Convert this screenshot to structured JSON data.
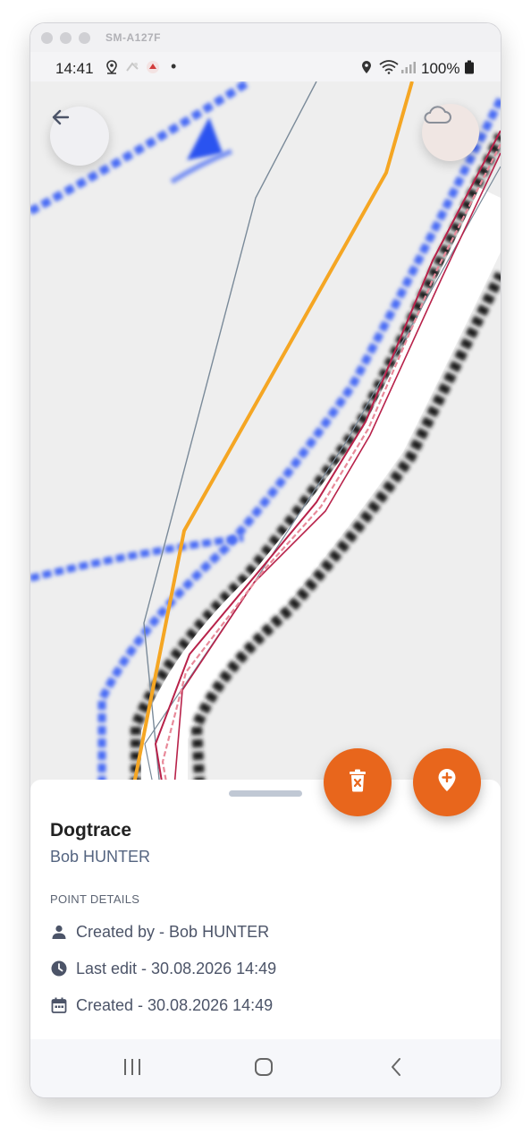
{
  "window": {
    "device_name": "SM-A127F"
  },
  "status_bar": {
    "time": "14:41",
    "battery": "100%",
    "notification_dot": "•"
  },
  "map": {
    "back_icon": "arrow-left-icon",
    "cloud_icon": "cloud-icon",
    "colors": {
      "track_orange": "#f5a623",
      "track_gray": "#7a8a99",
      "track_red": "#b8224a",
      "track_pink": "#e88a9a",
      "road_blue": "#4a6cf5",
      "road_black": "#1e1e1e"
    }
  },
  "actions": {
    "delete_icon": "trash-icon",
    "add_point_icon": "map-pin-plus-icon",
    "accent": "#e8661c"
  },
  "sheet": {
    "title": "Dogtrace",
    "subtitle": "Bob HUNTER",
    "section_label": "POINT DETAILS",
    "details": [
      {
        "icon": "person-icon",
        "text": "Created by - Bob HUNTER"
      },
      {
        "icon": "clock-icon",
        "text": "Last edit - 30.08.2026 14:49"
      },
      {
        "icon": "calendar-icon",
        "text": "Created - 30.08.2026 14:49"
      }
    ]
  },
  "nav_bar": {
    "recents_icon": "recents-icon",
    "home_icon": "home-icon",
    "back_icon": "back-chevron-icon"
  }
}
